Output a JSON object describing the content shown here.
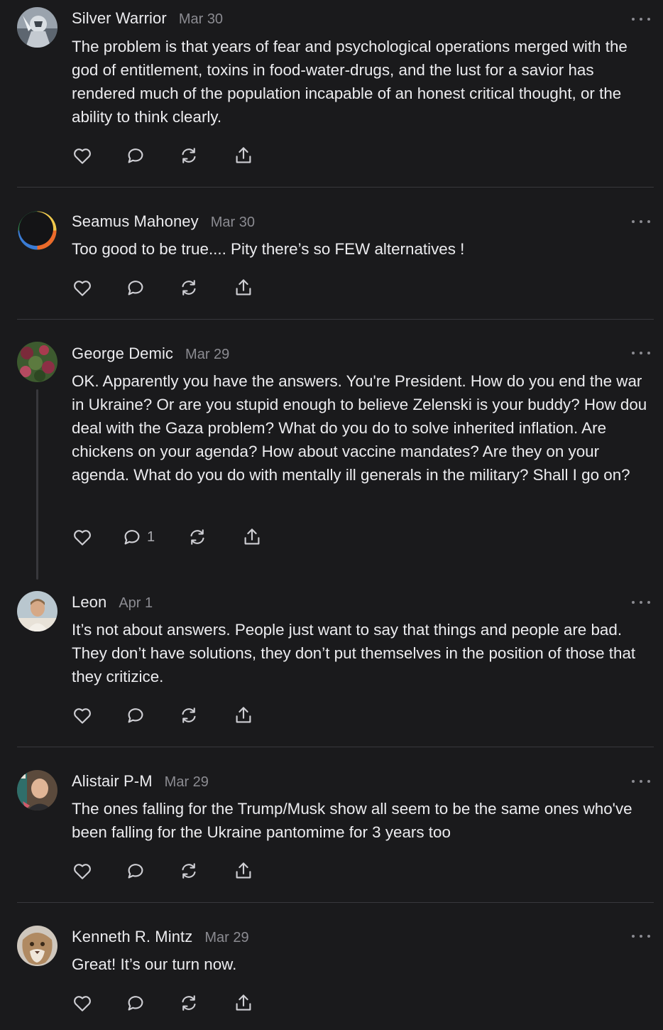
{
  "comments": [
    {
      "author": "Silver Warrior",
      "date": "Mar 30",
      "text": "The problem is that years of fear and psychological operations merged with the god of entitlement, toxins in food-water-drugs, and the lust for a savior has rendered much of the population incapable of an honest critical thought, or the ability to think clearly.",
      "avatar": "avatar-silver-warrior"
    },
    {
      "author": "Seamus Mahoney",
      "date": "Mar 30",
      "text": "Too good to be true.... Pity there’s so FEW alternatives !",
      "avatar": "avatar-seamus-mahoney"
    },
    {
      "author": "George Demic",
      "date": "Mar 29",
      "text": "OK. Apparently you have the answers. You're President. How do you end the war in Ukraine? Or are you stupid enough to believe Zelenski is your buddy? How dou deal with the Gaza problem? What do you do to solve inherited inflation. Are chickens on your agenda? How about vaccine mandates? Are they on your agenda. What do you do with mentally ill generals in the military? Shall I go on?",
      "reply_count": "1",
      "avatar": "avatar-george-demic"
    },
    {
      "author": "Leon",
      "date": "Apr 1",
      "text": "It’s not about answers. People just want to say that things and people are bad. They don’t have solutions, they don’t put themselves in the position of those that they critizice.",
      "avatar": "avatar-leon"
    },
    {
      "author": "Alistair P-M",
      "date": "Mar 29",
      "text": "The ones falling for the Trump/Musk show all seem to be the same ones who've been falling for the Ukraine pantomime for 3 years too",
      "avatar": "avatar-alistair"
    },
    {
      "author": "Kenneth R. Mintz",
      "date": "Mar 29",
      "text": "Great! It’s our turn now.",
      "avatar": "avatar-kenneth"
    }
  ],
  "icons": {
    "like": "heart-icon",
    "reply": "comment-bubble-icon",
    "restack": "restack-icon",
    "share": "share-icon",
    "more": "more-dots-icon"
  },
  "colors": {
    "background": "#1a1a1c",
    "text": "#ececef",
    "muted": "#8b8b91",
    "divider": "#38383c"
  }
}
